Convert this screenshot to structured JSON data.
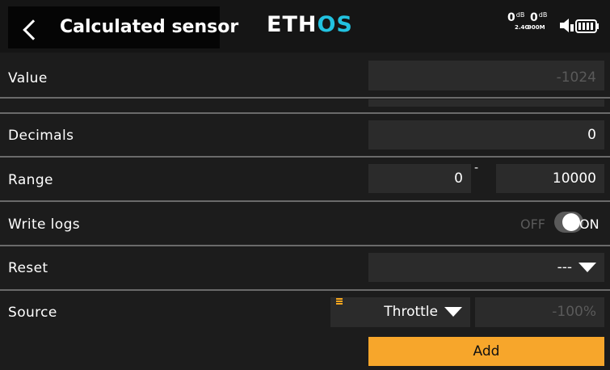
{
  "header": {
    "title": "Calculated sensor",
    "logo_main": "ETH",
    "logo_accent": "OS",
    "rssi": [
      {
        "value": "0",
        "unit": "dB",
        "band": "2.4G"
      },
      {
        "value": "0",
        "unit": "dB",
        "band": "900M"
      }
    ],
    "accent_color": "#22c2e0"
  },
  "rows": {
    "value": {
      "label": "Value",
      "field": "-1024"
    },
    "decimals": {
      "label": "Decimals",
      "field": "0"
    },
    "range": {
      "label": "Range",
      "min": "0",
      "separator": "-",
      "max": "10000"
    },
    "write_logs": {
      "label": "Write logs",
      "off_label": "OFF",
      "on_label": "ON",
      "state": "on"
    },
    "reset": {
      "label": "Reset",
      "selected": "---"
    },
    "source": {
      "label": "Source",
      "selected": "Throttle",
      "value": "-100%"
    }
  },
  "actions": {
    "add_label": "Add",
    "add_color": "#f7a62b"
  },
  "icons": [
    "chevron-left-icon",
    "speaker-icon",
    "battery-icon",
    "menu-icon",
    "dropdown-arrow-icon"
  ]
}
